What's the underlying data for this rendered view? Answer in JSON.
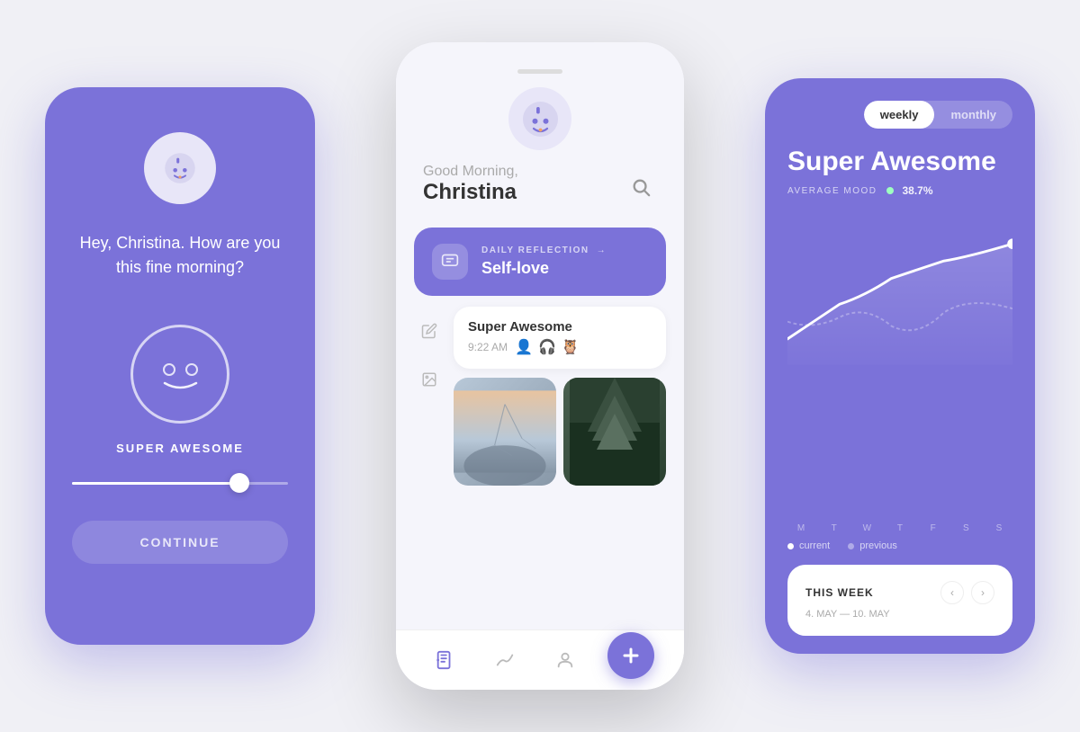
{
  "leftPhone": {
    "greeting": "Hey, Christina. How are you this fine morning?",
    "moodLabel": "SUPER AWESOME",
    "continueBtn": "CONTINUE",
    "sliderValue": 75
  },
  "centerPhone": {
    "subGreeting": "Good Morning,",
    "mainGreeting": "Christina",
    "dailyReflection": {
      "headerLabel": "DAILY REFLECTION",
      "arrow": "→",
      "title": "Self-love"
    },
    "entry": {
      "mood": "Super Awesome",
      "time": "9:22 AM"
    },
    "nav": {
      "addLabel": "+"
    }
  },
  "rightPhone": {
    "toggle": {
      "weekly": "weekly",
      "monthly": "monthly",
      "activeTab": "weekly"
    },
    "moodTitle": "Super Awesome",
    "avgMoodLabel": "AVERAGE MOOD",
    "avgMoodValue": "38.7%",
    "dayLabels": [
      "M",
      "T",
      "W",
      "T",
      "F",
      "S",
      "S"
    ],
    "legend": {
      "current": "current",
      "previous": "previous"
    },
    "weekCard": {
      "label": "THIS WEEK",
      "dateRange": "4. MAY — 10. MAY"
    }
  },
  "colors": {
    "purple": "#7B72D9",
    "lightPurple": "#9B93E8",
    "white": "#ffffff",
    "darkText": "#333333",
    "grayText": "#aaaaaa"
  }
}
